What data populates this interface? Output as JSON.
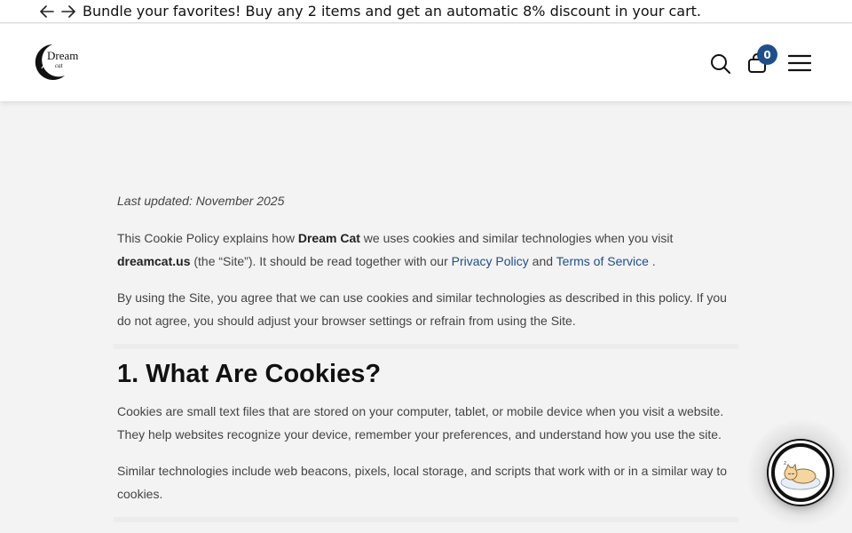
{
  "announcement": {
    "text": "Bundle your favorites! Buy any 2 items and get an automatic 8% discount in your cart.",
    "prev_icon": "arrow-left-icon",
    "next_icon": "arrow-right-icon"
  },
  "header": {
    "logo_text": "Dream",
    "logo_sub": "cat",
    "cart_count": "0",
    "icons": [
      "search-icon",
      "bag-icon",
      "menu-icon"
    ]
  },
  "policy": {
    "last_updated": "Last updated: November 2025",
    "intro": {
      "part1": "This Cookie Policy explains how ",
      "brand": "Dream Cat",
      "part2": " we uses cookies and similar technologies when you visit ",
      "site": "dreamcat.us",
      "part3": " (the “Site”). It should be read together with our ",
      "privacy_link": "Privacy Policy",
      "part4": " and ",
      "terms_link": "Terms of Service",
      "part5": " ."
    },
    "consent": "By using the Site, you agree that we can use cookies and similar technologies as described in this policy. If you do not agree, you should adjust your browser settings or refrain from using the Site.",
    "section1": {
      "heading": "1. What Are Cookies?",
      "p1": "Cookies are small text files that are stored on your computer, tablet, or mobile device when you visit a website. They help websites recognize your device, remember your preferences, and understand how you use the site.",
      "p2": "Similar technologies include web beacons, pixels, local storage, and scripts that work with or in a similar way to cookies."
    }
  },
  "colors": {
    "accent": "#1f4e8c",
    "background": "#f3f3f3",
    "header": "#ffffff"
  },
  "chat": {
    "icon": "sleeping-cat-chat-icon"
  }
}
